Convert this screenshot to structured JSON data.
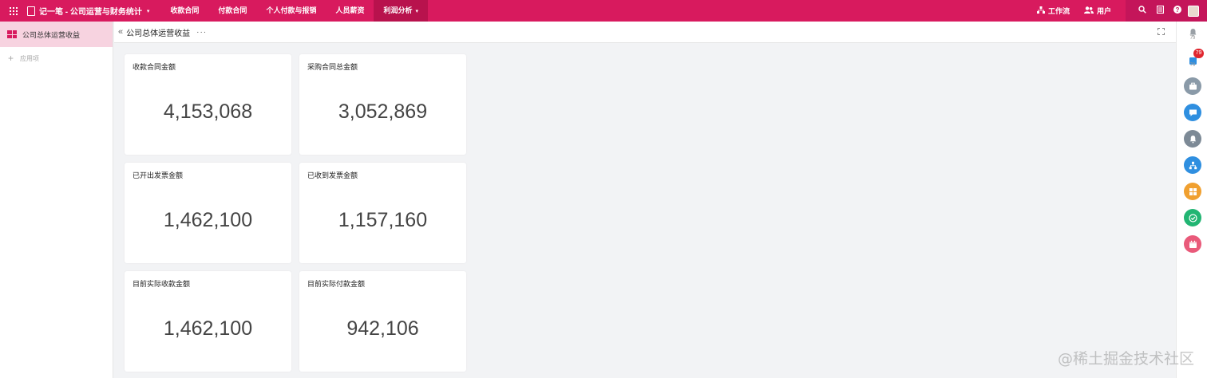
{
  "topbar": {
    "app_title": "记一笔 - 公司运营与财务统计",
    "menu": [
      {
        "label": "收款合同"
      },
      {
        "label": "付款合同"
      },
      {
        "label": "个人付款与报销"
      },
      {
        "label": "人员薪资"
      },
      {
        "label": "利润分析"
      }
    ],
    "workflow_label": "工作流",
    "users_label": "用户",
    "icons": [
      "grid-icon",
      "book-icon",
      "search-icon",
      "document-icon",
      "help-icon"
    ]
  },
  "sidebar": {
    "items": [
      {
        "label": "公司总体运营收益"
      }
    ],
    "add_label": "应用项"
  },
  "page": {
    "title": "公司总体运营收益",
    "more": "···"
  },
  "cards": [
    {
      "label": "收款合同金额",
      "value": "4,153,068"
    },
    {
      "label": "采购合同总金额",
      "value": "3,052,869"
    },
    {
      "label": "已开出发票金额",
      "value": "1,462,100"
    },
    {
      "label": "已收到发票金额",
      "value": "1,157,160"
    },
    {
      "label": "目前实际收款金额",
      "value": "1,462,100"
    },
    {
      "label": "目前实际付款金额",
      "value": "942,106"
    }
  ],
  "rightbar": {
    "notify_count": "79",
    "badge": "79",
    "second_count": "79",
    "icons": [
      "bell-icon",
      "task-icon",
      "briefcase-icon",
      "chat-icon",
      "notification-icon",
      "org-icon",
      "apps-icon",
      "check-icon",
      "calendar-icon"
    ],
    "colors": {
      "briefcase": "#8a9aa8",
      "chat": "#2f8fe0",
      "notification": "#7d8a96",
      "org": "#2f8fe0",
      "apps": "#f0a030",
      "check": "#22b573",
      "calendar": "#e95a7a"
    }
  },
  "colors": {
    "brand": "#d81a5e",
    "brand_dark": "#b8124d",
    "sidebar_active": "#f7d3e0"
  },
  "watermark": "@稀土掘金技术社区"
}
